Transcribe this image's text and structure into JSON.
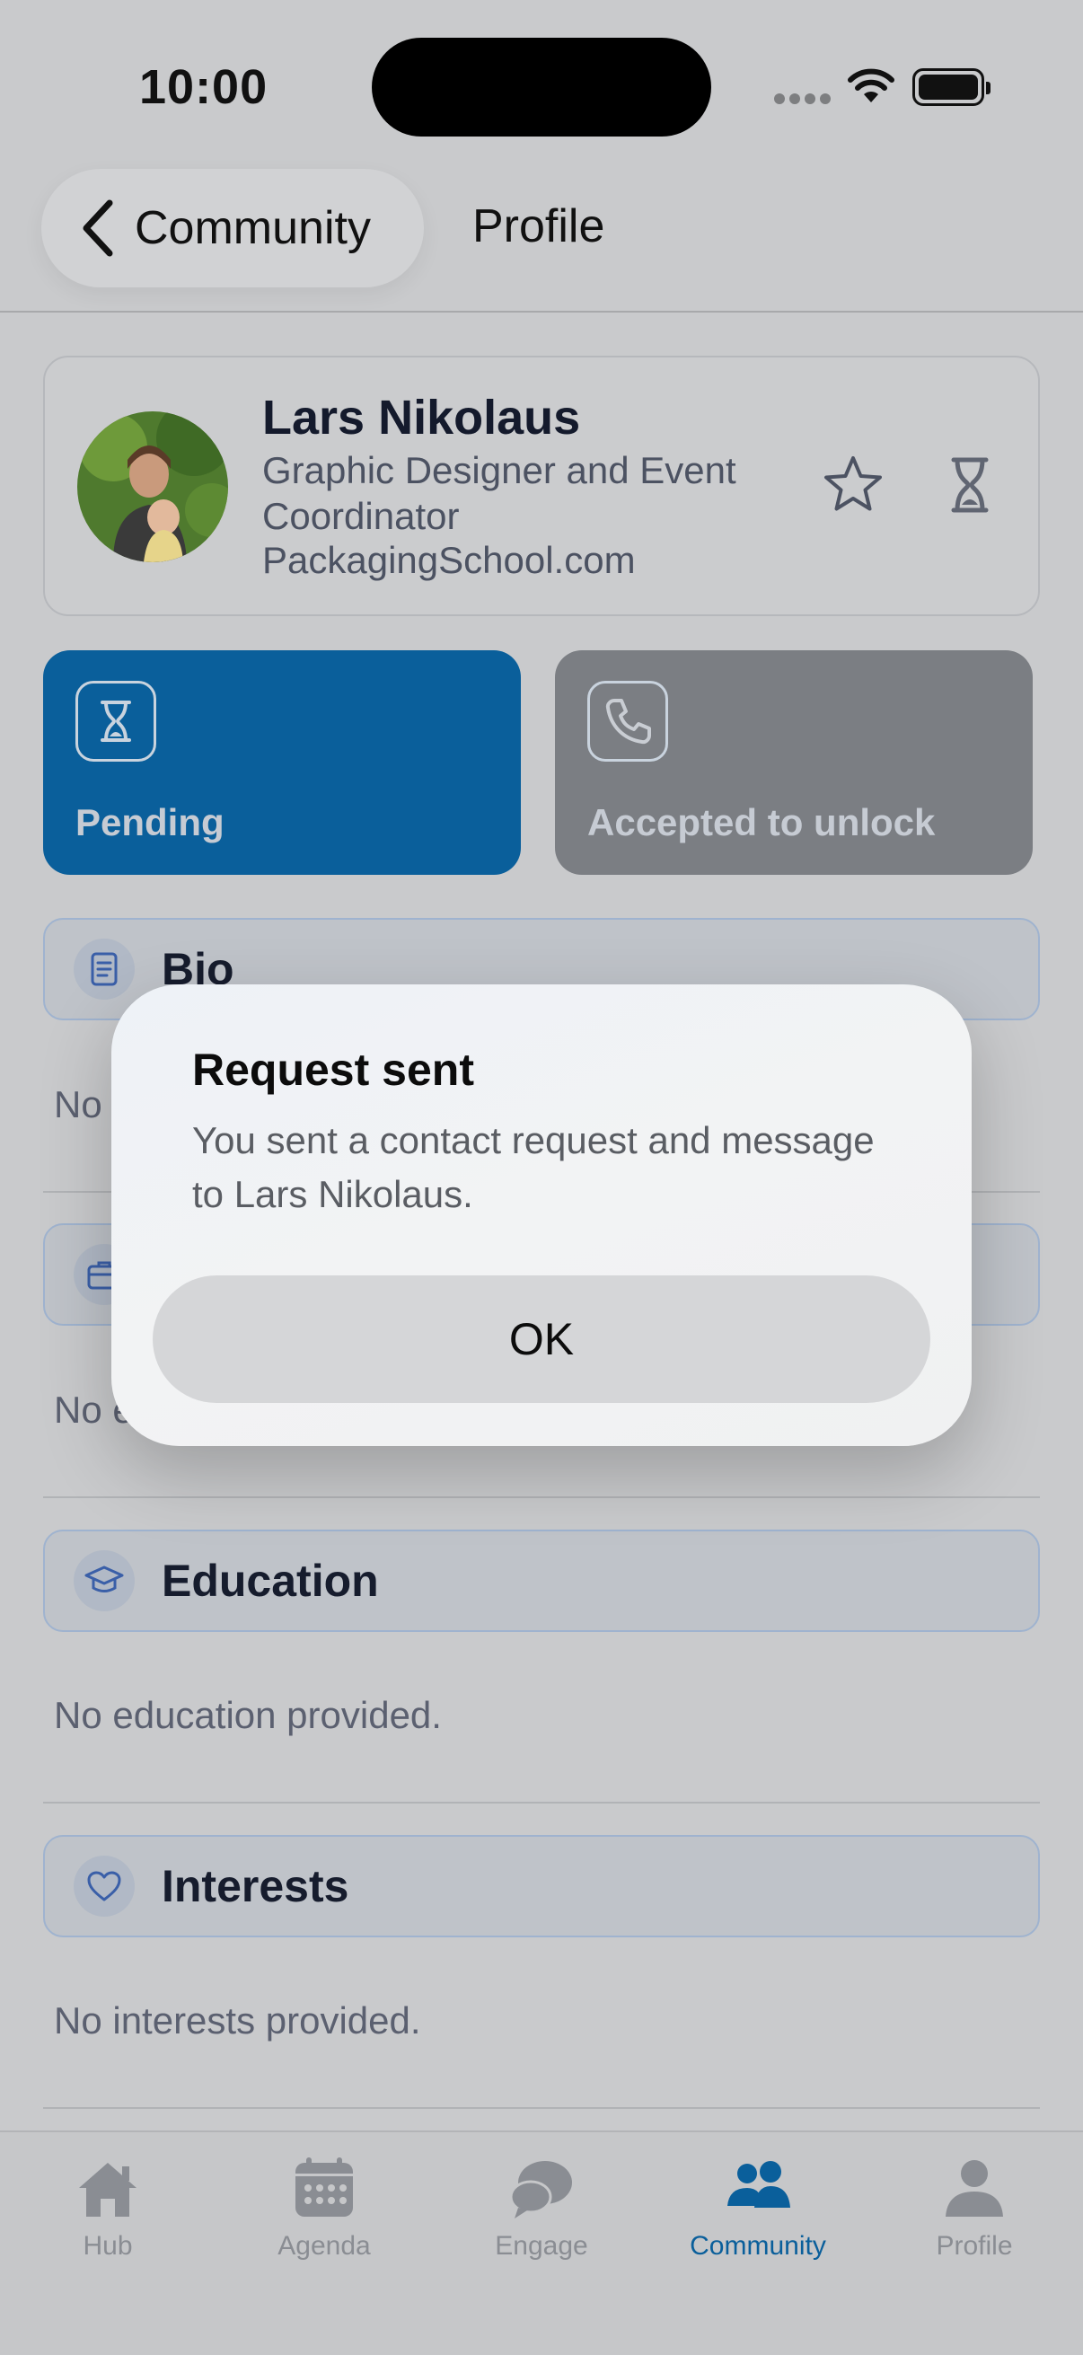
{
  "status_bar": {
    "time": "10:00"
  },
  "nav": {
    "back_label": "Community",
    "title": "Profile"
  },
  "profile": {
    "name": "Lars Nikolaus",
    "role": "Graphic Designer and Event Coordinator",
    "company": "PackagingSchool.com"
  },
  "status_tiles": {
    "pending_label": "Pending",
    "locked_label": "Accepted to unlock"
  },
  "sections": {
    "bio": {
      "title": "Bio",
      "empty_text": "No"
    },
    "experience": {
      "empty_text": "No e"
    },
    "education": {
      "title": "Education",
      "empty_text": "No education provided."
    },
    "interests": {
      "title": "Interests",
      "empty_text": "No interests provided."
    }
  },
  "tab_bar": {
    "items": [
      {
        "label": "Hub",
        "icon": "home-icon"
      },
      {
        "label": "Agenda",
        "icon": "calendar-icon"
      },
      {
        "label": "Engage",
        "icon": "chat-bubbles-icon"
      },
      {
        "label": "Community",
        "icon": "people-icon",
        "active": true
      },
      {
        "label": "Profile",
        "icon": "person-icon"
      }
    ]
  },
  "alert": {
    "title": "Request sent",
    "message": "You sent a contact request and message to Lars Nikolaus.",
    "ok_label": "OK"
  },
  "colors": {
    "accent": "#0a5f9b",
    "locked_tile": "#7b7e83",
    "section_border": "#9fb3cf"
  }
}
